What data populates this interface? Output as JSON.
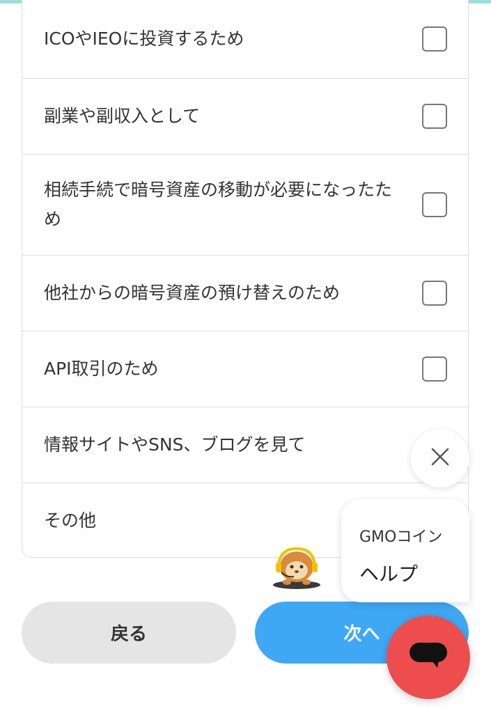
{
  "options": [
    {
      "label": "ICOやIEOに投資するため",
      "checked": false,
      "show_checkbox": true
    },
    {
      "label": "副業や副収入として",
      "checked": false,
      "show_checkbox": true
    },
    {
      "label": "相続手続で暗号資産の移動が必要になったため",
      "checked": false,
      "show_checkbox": true
    },
    {
      "label": "他社からの暗号資産の預け替えのため",
      "checked": false,
      "show_checkbox": true
    },
    {
      "label": "API取引のため",
      "checked": false,
      "show_checkbox": true
    },
    {
      "label": "情報サイトやSNS、ブログを見て",
      "checked": false,
      "show_checkbox": false
    },
    {
      "label": "その他",
      "checked": false,
      "show_checkbox": false
    }
  ],
  "buttons": {
    "back_label": "戻る",
    "next_label": "次へ"
  },
  "help_widget": {
    "brand": "GMOコイン",
    "title": "ヘルプ"
  },
  "icons": {
    "close": "close-icon",
    "chat": "chat-bubble-icon",
    "mascot": "mascot-icon"
  },
  "colors": {
    "accent_top": "#9fdcdc",
    "next_button": "#3ea8f5",
    "back_button": "#e5e5e5",
    "chat_launcher": "#ee4d4d"
  }
}
